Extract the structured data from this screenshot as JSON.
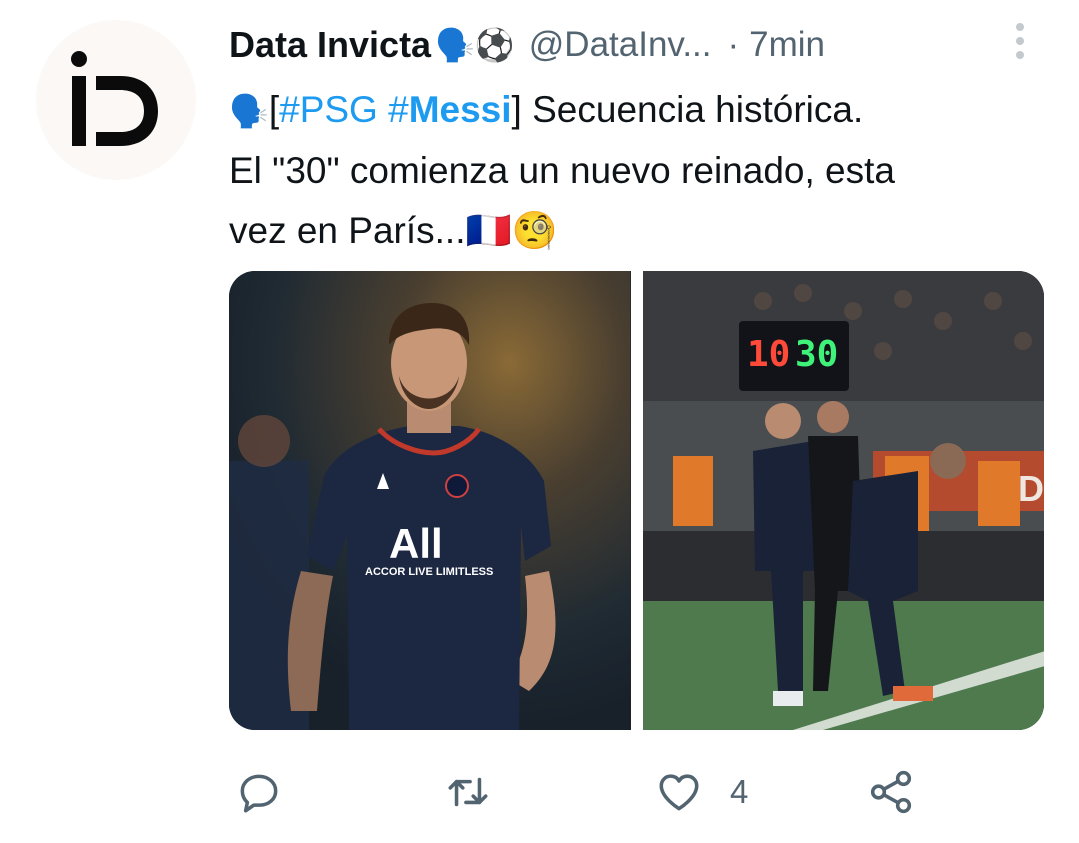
{
  "tweet": {
    "author_name": "Data Invicta",
    "author_emoji": "🗣️⚽",
    "handle": "@DataInv...",
    "separator": "·",
    "time": "7min",
    "text_line1_emoji": "🗣️",
    "text_line1_open": "[",
    "hashtag1": "#PSG",
    "hashtag2_prefix": "#",
    "hashtag2_bold": "Messi",
    "text_line1_rest": "] Secuencia histórica.",
    "text_line2": "El \"30\" comienza un nuevo reinado, esta",
    "text_line3": "vez en París...🇫🇷🧐",
    "media": {
      "left_jersey_text": "All",
      "left_jersey_sub": "ACCOR LIVE LIMITLESS",
      "board_red": "10",
      "board_green": "30"
    },
    "actions": {
      "like_count": "4"
    }
  },
  "colors": {
    "link": "#1d9bf0",
    "muted": "#536471",
    "text": "#0f1419"
  },
  "icons": [
    "reply-icon",
    "retweet-icon",
    "like-icon",
    "share-icon",
    "more-icon"
  ]
}
